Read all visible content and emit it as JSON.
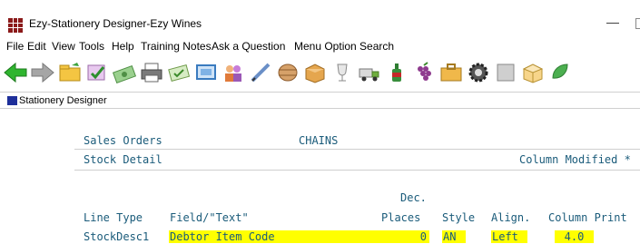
{
  "window": {
    "title": "Ezy-Stationery Designer-Ezy Wines",
    "minimize_glyph": "—"
  },
  "menu": [
    "File",
    "Edit",
    "View",
    "Tools",
    "Help",
    "Training Notes",
    "Ask a Question",
    "Menu Option Search"
  ],
  "toolbar_icons": [
    "back-arrow-icon",
    "forward-arrow-icon",
    "folder-icon",
    "check-icon",
    "cash-icon",
    "printer-icon",
    "check-form-icon",
    "screen-icon",
    "people-icon",
    "pen-icon",
    "barrel-icon",
    "box-icon",
    "wine-glass-icon",
    "truck-icon",
    "bottle-icon",
    "grapes-icon",
    "briefcase-icon",
    "settings-gear-icon",
    "stop-icon",
    "cube-icon",
    "leaf-icon"
  ],
  "document": {
    "title": "Stationery Designer",
    "form_name": "Sales Orders",
    "form_code": "CHAINS",
    "section": "Stock Detail",
    "status": "Column Modified *",
    "headers": {
      "dec_line1": "Dec.",
      "line_type": "Line Type",
      "field": "Field/\"Text\"",
      "places": "Places",
      "style": "Style",
      "align": "Align.",
      "column_print": "Column Print"
    },
    "row": {
      "line_type": "StockDesc1",
      "field": "Debtor Item Code",
      "places": "0",
      "style": "AN",
      "align": "Left",
      "column_print": "4.0"
    }
  },
  "colors": {
    "text": "#1a5b7a",
    "highlight": "#ffff00",
    "doc_icon": "#1e2f9a",
    "app_icon": "#8b1a1a"
  }
}
